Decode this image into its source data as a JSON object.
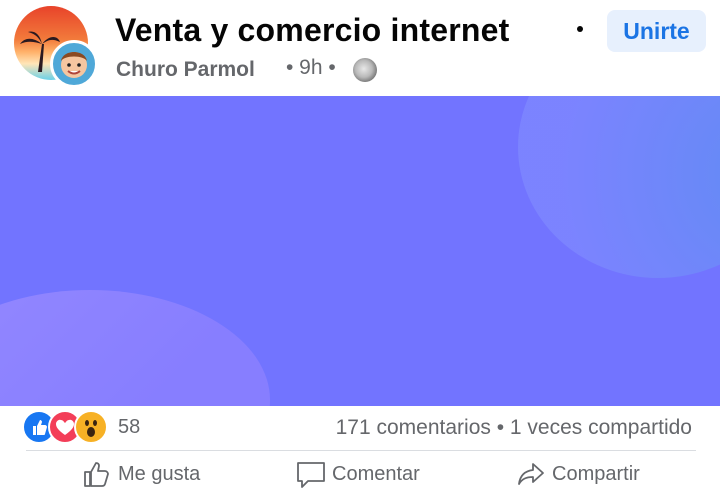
{
  "post": {
    "group_name": "Venta y comercio internet",
    "author": "Churo Parmol",
    "time": "• 9h •",
    "join_label": "Unirte"
  },
  "stats": {
    "reaction_count": "58",
    "comments_shares": "171 comentarios • 1 veces compartido"
  },
  "actions": {
    "like": "Me gusta",
    "comment": "Comentar",
    "share": "Compartir"
  },
  "icons": [
    "like-reaction-icon",
    "love-reaction-icon",
    "wow-reaction-icon",
    "privacy-globe-icon",
    "thumbs-up-icon",
    "comment-icon",
    "share-icon"
  ],
  "colors": {
    "media_background": "#7274ff",
    "join_button_text": "#1b74e4"
  }
}
